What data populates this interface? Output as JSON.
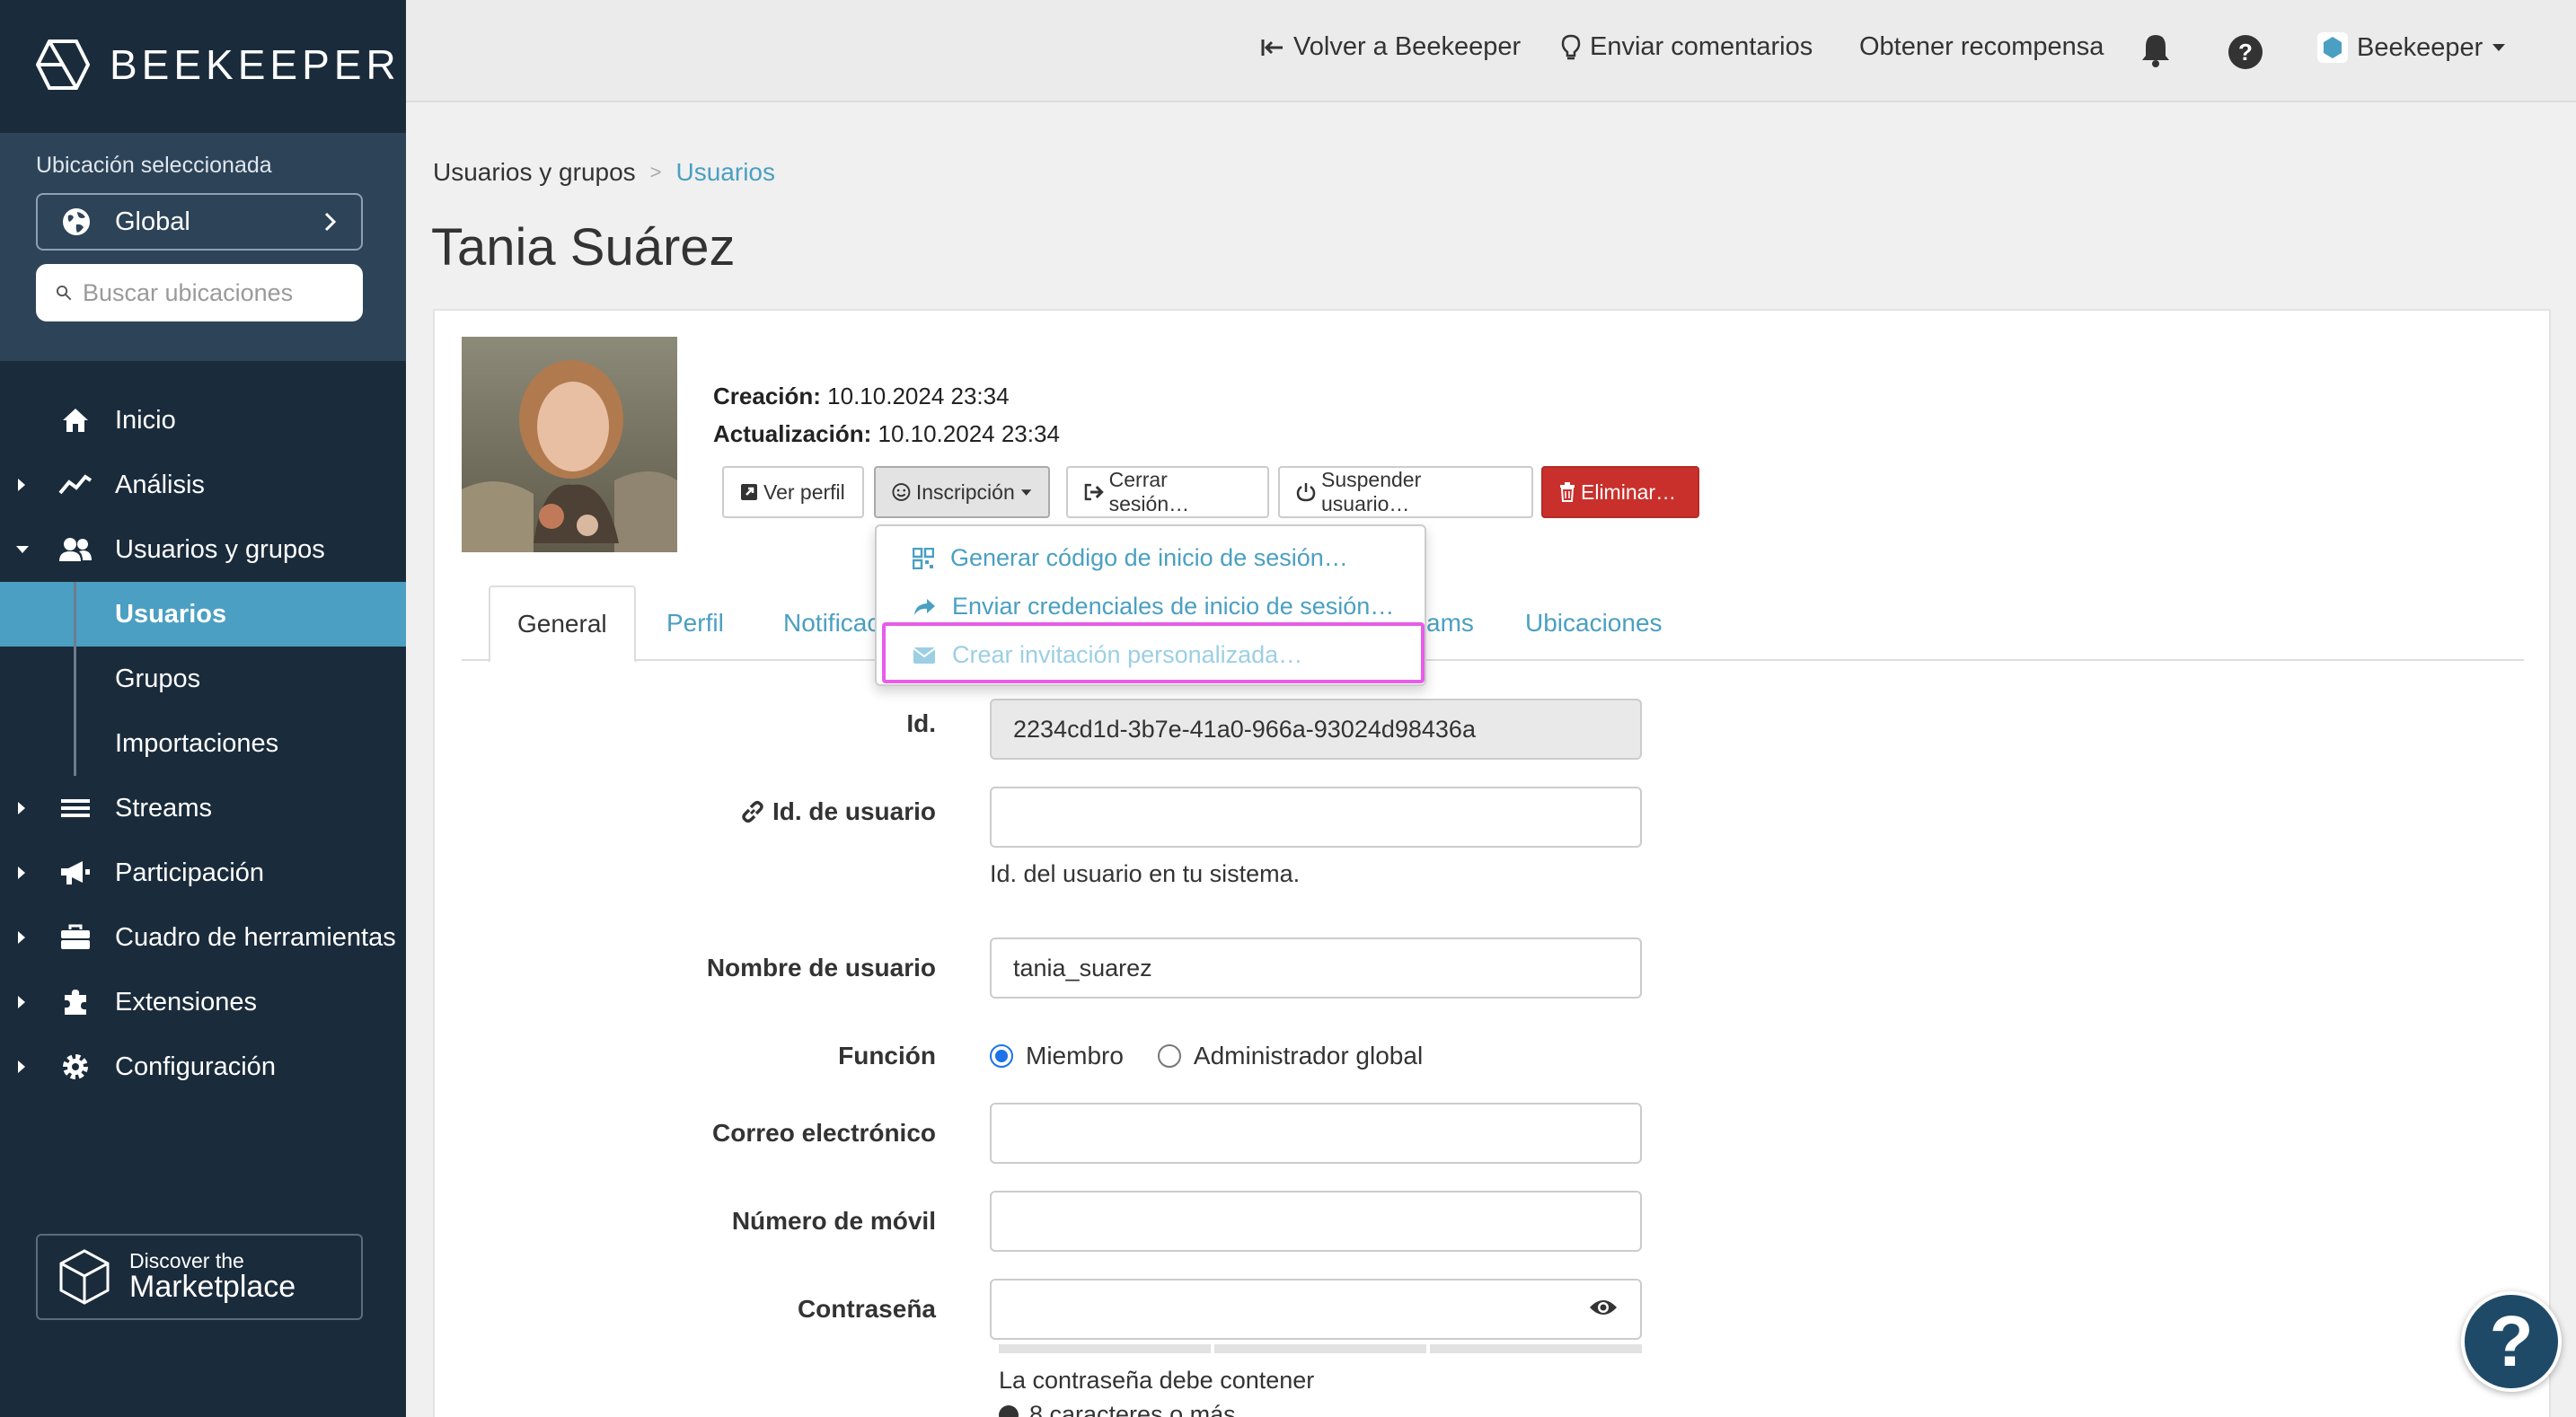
{
  "brand": {
    "name": "BEEKEEPER"
  },
  "sidebar": {
    "location_label": "Ubicación seleccionada",
    "location_value": "Global",
    "search_placeholder": "Buscar ubicaciones",
    "items": [
      {
        "label": "Inicio",
        "icon": "home-icon"
      },
      {
        "label": "Análisis",
        "icon": "chart-line-icon"
      },
      {
        "label": "Usuarios y grupos",
        "icon": "users-icon"
      },
      {
        "label": "Streams",
        "icon": "list-icon"
      },
      {
        "label": "Participación",
        "icon": "megaphone-icon"
      },
      {
        "label": "Cuadro de herramientas",
        "icon": "toolbox-icon"
      },
      {
        "label": "Extensiones",
        "icon": "puzzle-icon"
      },
      {
        "label": "Configuración",
        "icon": "gear-icon"
      }
    ],
    "sub_items": [
      "Usuarios",
      "Grupos",
      "Importaciones"
    ],
    "marketplace_line1": "Discover the",
    "marketplace_line2": "Marketplace"
  },
  "topbar": {
    "back": "Volver a Beekeeper",
    "feedback": "Enviar comentarios",
    "reward": "Obtener recompensa",
    "account": "Beekeeper"
  },
  "breadcrumb": {
    "parent": "Usuarios y grupos",
    "separator": ">",
    "current": "Usuarios"
  },
  "page": {
    "title": "Tania Suárez"
  },
  "meta": {
    "created_label": "Creación:",
    "created_value": "10.10.2024 23:34",
    "updated_label": "Actualización:",
    "updated_value": "10.10.2024 23:34"
  },
  "actions": {
    "view_profile": "Ver perfil",
    "enrollment": "Inscripción",
    "logout": "Cerrar sesión…",
    "suspend": "Suspender usuario…",
    "delete": "Eliminar…"
  },
  "dropdown": {
    "items": [
      "Generar código de inicio de sesión…",
      "Enviar credenciales de inicio de sesión…",
      "Crear invitación personalizada…"
    ]
  },
  "tabs": {
    "general": "General",
    "profile": "Perfil",
    "notifications_partial": "Notificac",
    "streams_partial": "ams",
    "locations": "Ubicaciones"
  },
  "form": {
    "id_label": "Id.",
    "id_value": "2234cd1d-3b7e-41a0-966a-93024d98436a",
    "user_id_label": "Id. de usuario",
    "user_id_value": "",
    "user_id_help": "Id. del usuario en tu sistema.",
    "username_label": "Nombre de usuario",
    "username_value": "tania_suarez",
    "role_label": "Función",
    "role_member": "Miembro",
    "role_admin": "Administrador global",
    "email_label": "Correo electrónico",
    "email_value": "",
    "mobile_label": "Número de móvil",
    "mobile_value": "",
    "password_label": "Contraseña",
    "password_value": "",
    "password_help": "La contraseña debe contener",
    "password_rule_partial": "8 caracteres o más"
  },
  "colors": {
    "sidebar": "#1a2b3b",
    "accent": "#4a9fc2",
    "danger": "#c9302c",
    "highlight": "#e85ce8"
  }
}
